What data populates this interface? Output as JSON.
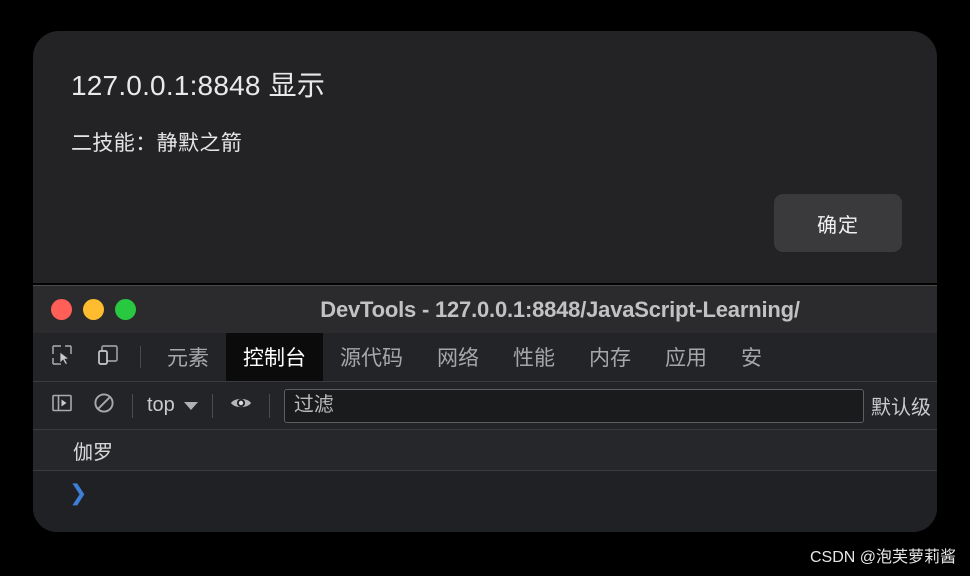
{
  "alert_dialog": {
    "origin_title": "127.0.0.1:8848 显示",
    "message": "二技能：静默之箭",
    "ok_label": "确定"
  },
  "devtools": {
    "window_title": "DevTools - 127.0.0.1:8848/JavaScript-Learning/",
    "traffic_lights": {
      "close_color": "#ff5f57",
      "minimize_color": "#febc2e",
      "maximize_color": "#28c840"
    },
    "toolbar_icons": {
      "inspect": "inspect-element-icon",
      "device": "device-toolbar-icon"
    },
    "tabs": [
      {
        "label": "元素",
        "active": false
      },
      {
        "label": "控制台",
        "active": true
      },
      {
        "label": "源代码",
        "active": false
      },
      {
        "label": "网络",
        "active": false
      },
      {
        "label": "性能",
        "active": false
      },
      {
        "label": "内存",
        "active": false
      },
      {
        "label": "应用",
        "active": false
      },
      {
        "label": "安",
        "active": false
      }
    ],
    "console_toolbar": {
      "sidebar_icon": "console-sidebar-icon",
      "clear_icon": "clear-console-icon",
      "context_label": "top",
      "eye_icon": "live-expression-eye-icon",
      "filter_placeholder": "过滤",
      "filter_value": "",
      "levels_label": "默认级"
    },
    "console_messages": [
      {
        "text": "伽罗"
      }
    ],
    "prompt_symbol": "❯"
  },
  "watermark": {
    "text": "CSDN @泡芙萝莉酱"
  }
}
